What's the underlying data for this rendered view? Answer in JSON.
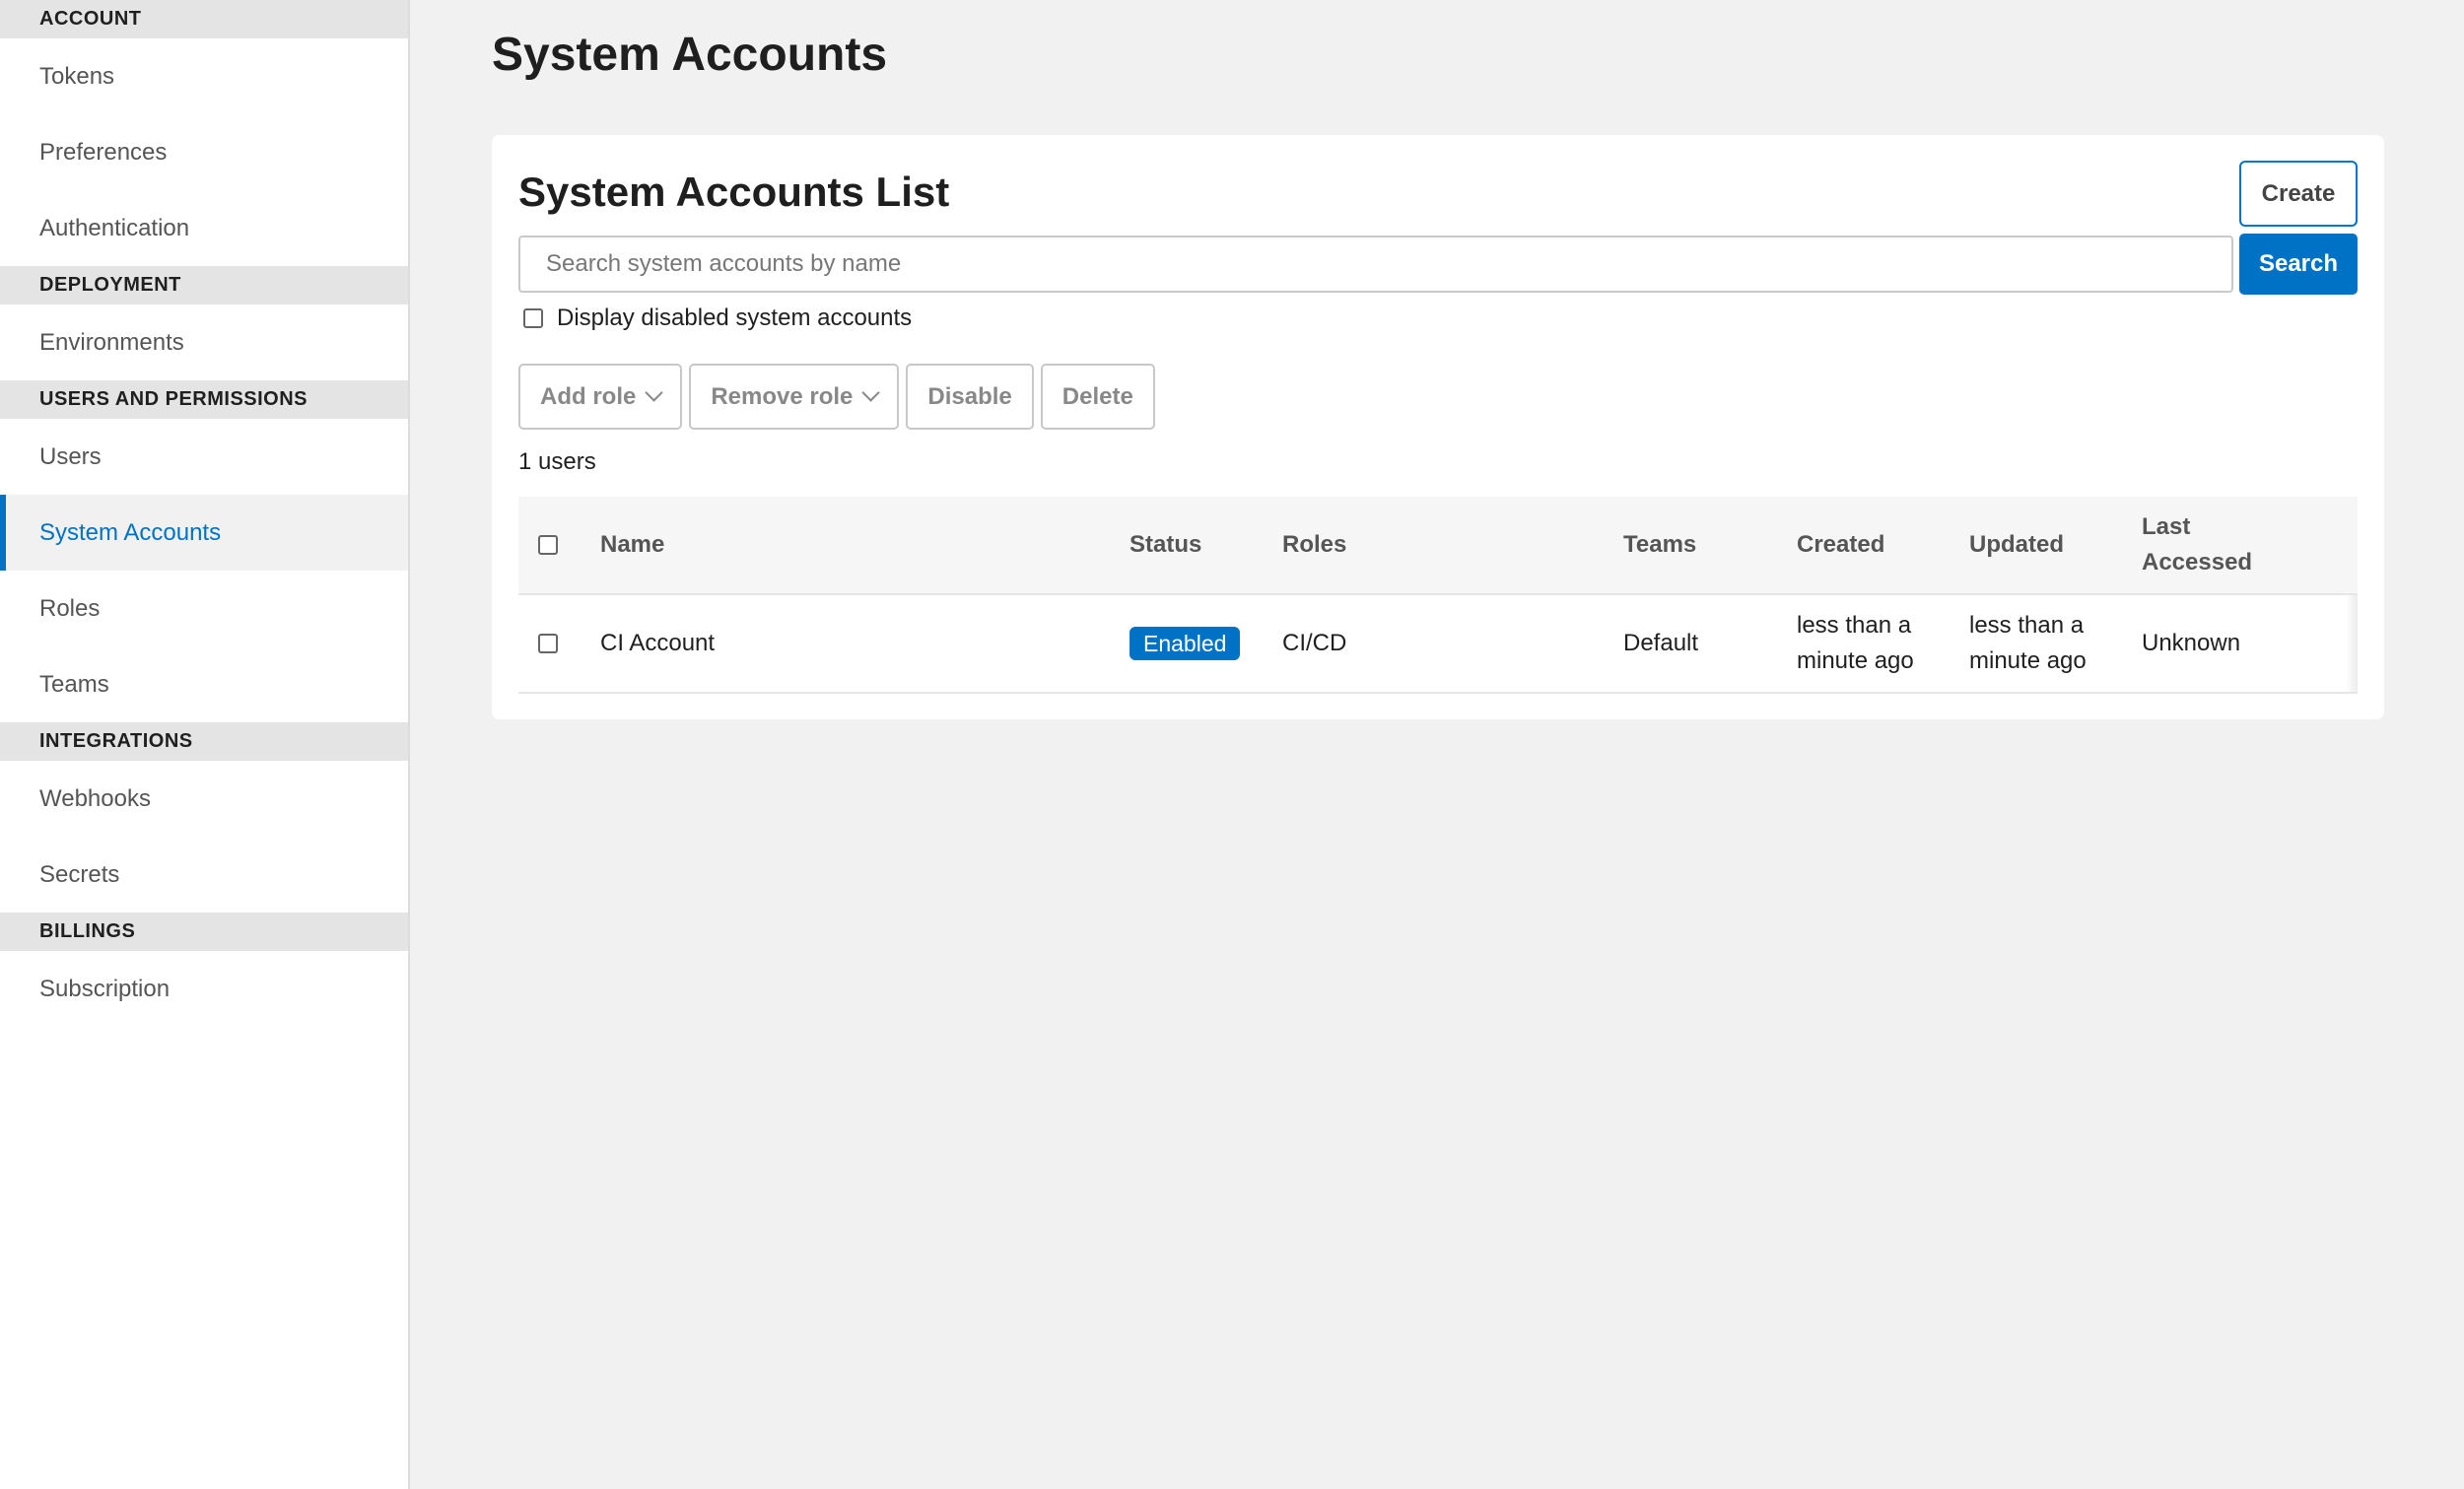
{
  "sidebar": {
    "sections": [
      {
        "header": "ACCOUNT",
        "items": [
          "Tokens",
          "Preferences",
          "Authentication"
        ]
      },
      {
        "header": "DEPLOYMENT",
        "items": [
          "Environments"
        ]
      },
      {
        "header": "USERS AND PERMISSIONS",
        "items": [
          "Users",
          "System Accounts",
          "Roles",
          "Teams"
        ]
      },
      {
        "header": "INTEGRATIONS",
        "items": [
          "Webhooks",
          "Secrets"
        ]
      },
      {
        "header": "BILLINGS",
        "items": [
          "Subscription"
        ]
      }
    ],
    "active_item": "System Accounts"
  },
  "page": {
    "title": "System Accounts"
  },
  "card": {
    "title": "System Accounts List",
    "create_label": "Create",
    "search_placeholder": "Search system accounts by name",
    "search_value": "",
    "search_label": "Search",
    "display_disabled_label": "Display disabled system accounts",
    "display_disabled_checked": false,
    "actions": {
      "add_role": "Add role",
      "remove_role": "Remove role",
      "disable": "Disable",
      "delete": "Delete"
    },
    "count_label": "1 users"
  },
  "table": {
    "headers": {
      "name": "Name",
      "status": "Status",
      "roles": "Roles",
      "teams": "Teams",
      "created": "Created",
      "updated": "Updated",
      "last_accessed": "Last Accessed"
    },
    "rows": [
      {
        "name": "CI Account",
        "status": "Enabled",
        "roles": "CI/CD",
        "teams": "Default",
        "created": "less than a minute ago",
        "updated": "less than a minute ago",
        "last_accessed": "Unknown"
      }
    ]
  },
  "colors": {
    "accent": "#0072c6",
    "background": "#f0f1f0",
    "section_header_bg": "#e3e4e3"
  }
}
